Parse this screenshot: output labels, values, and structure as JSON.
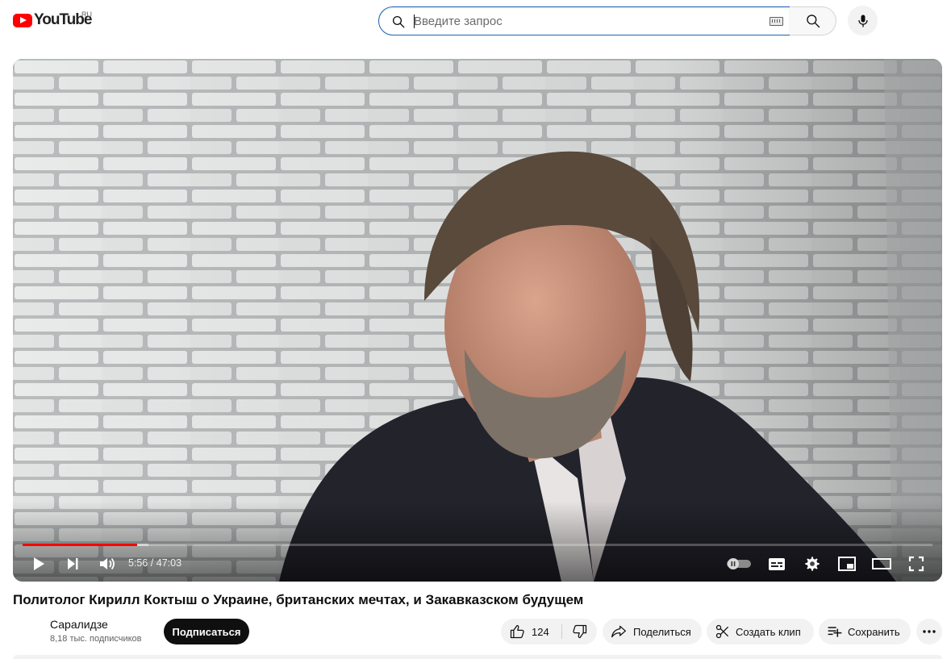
{
  "masthead": {
    "logo_text": "YouTube",
    "region": "RU",
    "search": {
      "placeholder": "Введите запрос",
      "value": ""
    }
  },
  "player": {
    "time_display": "5:56 / 47:03",
    "progress_played": 0.126,
    "progress_loaded": 0.138
  },
  "video": {
    "title": "Политолог Кирилл Коктыш о Украине, британских мечтах, и Закавказском будущем"
  },
  "channel": {
    "name": "Саралидзе",
    "subscribers": "8,18 тыс. подписчиков",
    "subscribe_label": "Подписаться"
  },
  "actions": {
    "like_count": "124",
    "share_label": "Поделиться",
    "clip_label": "Создать клип",
    "save_label": "Сохранить"
  },
  "colors": {
    "brand_red": "#ff0000",
    "search_focus": "#1c62b9",
    "pill_bg": "#f2f2f2"
  }
}
